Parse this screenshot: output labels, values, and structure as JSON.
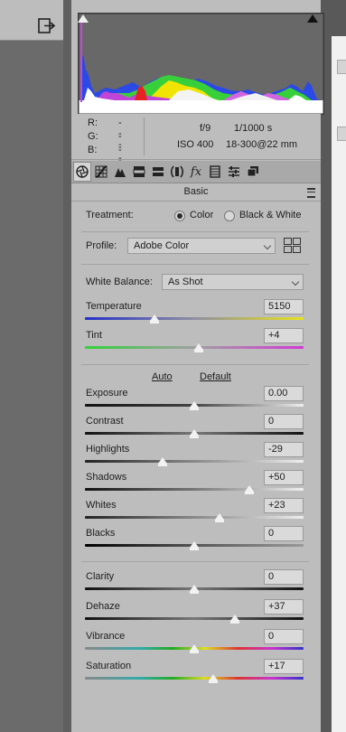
{
  "histogram_info": {
    "r_label": "R:",
    "g_label": "G:",
    "b_label": "B:",
    "r_value": "---",
    "g_value": "---",
    "b_value": "---",
    "aperture": "f/9",
    "shutter": "1/1000 s",
    "iso": "ISO 400",
    "lens": "18-300@22 mm"
  },
  "panel": {
    "title": "Basic",
    "treatment_label": "Treatment:",
    "treatment_color": "Color",
    "treatment_bw": "Black & White",
    "profile_label": "Profile:",
    "profile_value": "Adobe Color",
    "wb_label": "White Balance:",
    "wb_value": "As Shot",
    "auto_label": "Auto",
    "default_label": "Default"
  },
  "sliders": [
    {
      "label": "Temperature",
      "value": "5150",
      "level": 0.32
    },
    {
      "label": "Tint",
      "value": "+4",
      "level": 0.52
    },
    {
      "label": "Exposure",
      "value": "0.00",
      "level": 0.5
    },
    {
      "label": "Contrast",
      "value": "0",
      "level": 0.5
    },
    {
      "label": "Highlights",
      "value": "-29",
      "level": 0.355
    },
    {
      "label": "Shadows",
      "value": "+50",
      "level": 0.75
    },
    {
      "label": "Whites",
      "value": "+23",
      "level": 0.615
    },
    {
      "label": "Blacks",
      "value": "0",
      "level": 0.5
    },
    {
      "label": "Clarity",
      "value": "0",
      "level": 0.5
    },
    {
      "label": "Dehaze",
      "value": "+37",
      "level": 0.685
    },
    {
      "label": "Vibrance",
      "value": "0",
      "level": 0.5
    },
    {
      "label": "Saturation",
      "value": "+17",
      "level": 0.585
    }
  ],
  "tools": [
    "basic-icon",
    "tone-curve-icon",
    "detail-icon",
    "hsl-icon",
    "split-toning-icon",
    "lens-corrections-icon",
    "effects-icon",
    "calibration-icon",
    "presets-icon",
    "snapshots-icon"
  ]
}
